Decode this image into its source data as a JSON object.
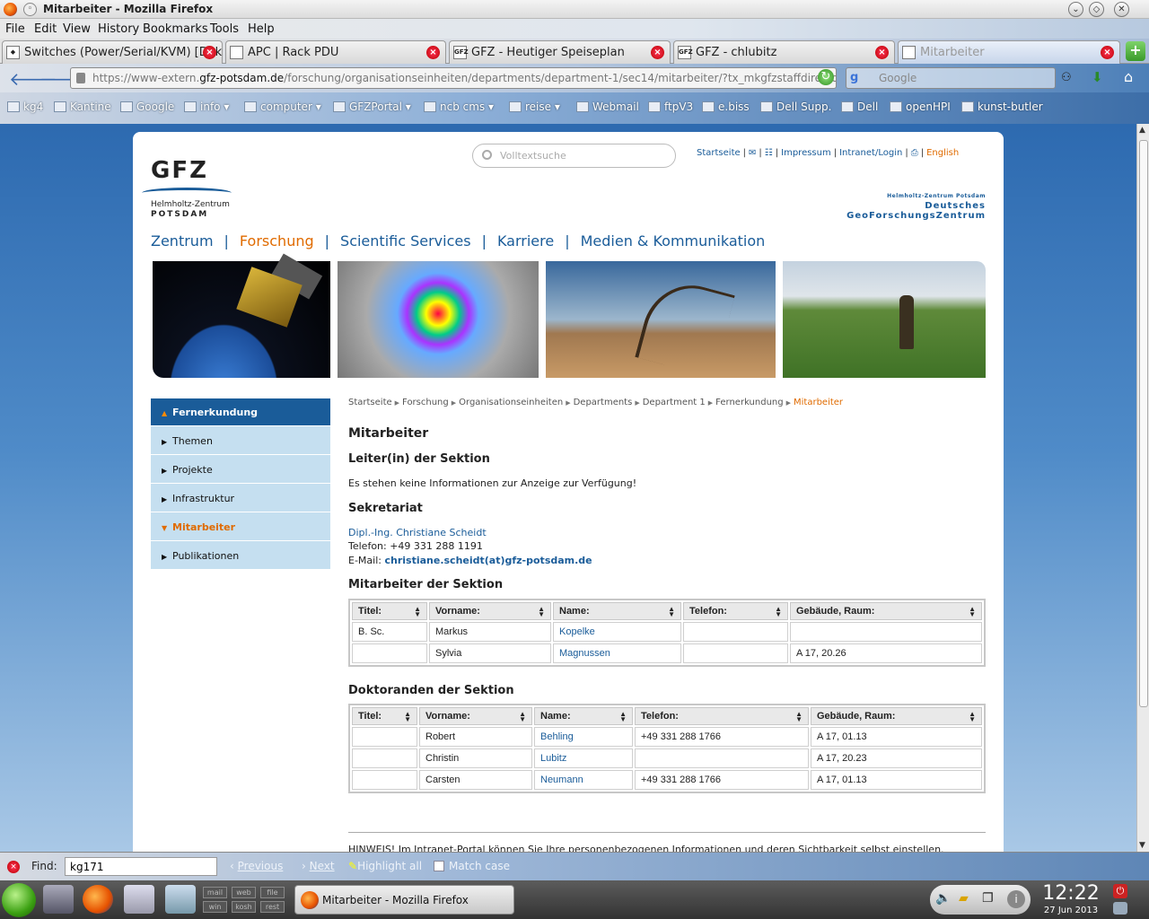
{
  "window": {
    "title": "Mitarbeiter - Mozilla Firefox"
  },
  "menubar": [
    "File",
    "Edit",
    "View",
    "History",
    "Bookmarks",
    "Tools",
    "Help"
  ],
  "tabs": [
    {
      "label": "Switches (Power/Serial/KVM) [Dok...",
      "active": false
    },
    {
      "label": "APC | Rack PDU",
      "active": false
    },
    {
      "label": "GFZ - Heutiger Speiseplan",
      "active": false
    },
    {
      "label": "GFZ - chlubitz",
      "active": false
    },
    {
      "label": "Mitarbeiter",
      "active": true
    }
  ],
  "nav": {
    "url_prefix": "https://www-extern.",
    "url_domain": "gfz-potsdam.de",
    "url_rest": "/forschung/organisationseinheiten/departments/department-1/sec14/mitarbeiter/?tx_mkgfzstaffdirectory_nc",
    "search_engine": "g",
    "search_placeholder": "Google"
  },
  "bookmarks": [
    {
      "label": "kg4"
    },
    {
      "label": "Kantine"
    },
    {
      "label": "Google"
    },
    {
      "label": "info"
    },
    {
      "label": "computer"
    },
    {
      "label": "GFZPortal"
    },
    {
      "label": "ncb cms"
    },
    {
      "label": "reise"
    },
    {
      "label": "Webmail"
    },
    {
      "label": "ftpV3"
    },
    {
      "label": "e.biss"
    },
    {
      "label": "Dell Supp."
    },
    {
      "label": "Dell"
    },
    {
      "label": "openHPI"
    },
    {
      "label": "kunst-butler"
    }
  ],
  "site": {
    "search_placeholder": "Volltextsuche",
    "toplinks": {
      "home": "Startseite",
      "impressum": "Impressum",
      "intranet": "Intranet/Login",
      "english": "English"
    },
    "logo": {
      "text": "GFZ",
      "line1": "Helmholtz-Zentrum",
      "line2": "POTSDAM"
    },
    "fullname": {
      "line1": "Helmholtz-Zentrum Potsdam",
      "line2": "Deutsches",
      "line3": "GeoForschungsZentrum"
    },
    "mainnav": [
      "Zentrum",
      "Forschung",
      "Scientific Services",
      "Karriere",
      "Medien & Kommunikation"
    ],
    "sidenav": [
      {
        "label": "Fernerkundung",
        "type": "head"
      },
      {
        "label": "Themen",
        "type": "item"
      },
      {
        "label": "Projekte",
        "type": "item"
      },
      {
        "label": "Infrastruktur",
        "type": "item"
      },
      {
        "label": "Mitarbeiter",
        "type": "current"
      },
      {
        "label": "Publikationen",
        "type": "item"
      }
    ],
    "breadcrumb": [
      "Startseite",
      "Forschung",
      "Organisationseinheiten",
      "Departments",
      "Department 1",
      "Fernerkundung",
      "Mitarbeiter"
    ],
    "page_title": "Mitarbeiter",
    "leiter": {
      "heading": "Leiter(in) der Sektion",
      "text": "Es stehen keine Informationen zur Anzeige zur Verfügung!"
    },
    "sekretariat": {
      "heading": "Sekretariat",
      "name": "Dipl.-Ing. Christiane Scheidt",
      "phone": "Telefon: +49 331 288 1191",
      "email_label": "E-Mail:",
      "email": "christiane.scheidt(at)gfz-potsdam.de"
    },
    "mitarbeiter": {
      "heading": "Mitarbeiter der Sektion",
      "columns": [
        "Titel:",
        "Vorname:",
        "Name:",
        "Telefon:",
        "Gebäude, Raum:"
      ],
      "rows": [
        [
          "B. Sc.",
          "Markus",
          "Kopelke",
          "",
          ""
        ],
        [
          "",
          "Sylvia",
          "Magnussen",
          "",
          "A 17, 20.26"
        ]
      ]
    },
    "doktoranden": {
      "heading": "Doktoranden der Sektion",
      "columns": [
        "Titel:",
        "Vorname:",
        "Name:",
        "Telefon:",
        "Gebäude, Raum:"
      ],
      "rows": [
        [
          "",
          "Robert",
          "Behling",
          "+49 331 288 1766",
          "A 17, 01.13"
        ],
        [
          "",
          "Christin",
          "Lubitz",
          "",
          "A 17, 20.23"
        ],
        [
          "",
          "Carsten",
          "Neumann",
          "+49 331 288 1766",
          "A 17, 01.13"
        ]
      ]
    },
    "hinweis": "HINWEIS! Im Intranet-Portal können Sie Ihre personenbezogenen Informationen und deren Sichtbarkeit selbst einstellen."
  },
  "findbar": {
    "label": "Find:",
    "value": "kg171",
    "previous": "Previous",
    "next": "Next",
    "highlight": "Highlight all",
    "matchcase": "Match case"
  },
  "taskbar": {
    "task": "Mitarbeiter - Mozilla Firefox",
    "time": "12:22",
    "date": "27 Jun 2013",
    "mini": [
      "mail",
      "web",
      "file",
      "win",
      "kosh",
      "rest"
    ]
  }
}
